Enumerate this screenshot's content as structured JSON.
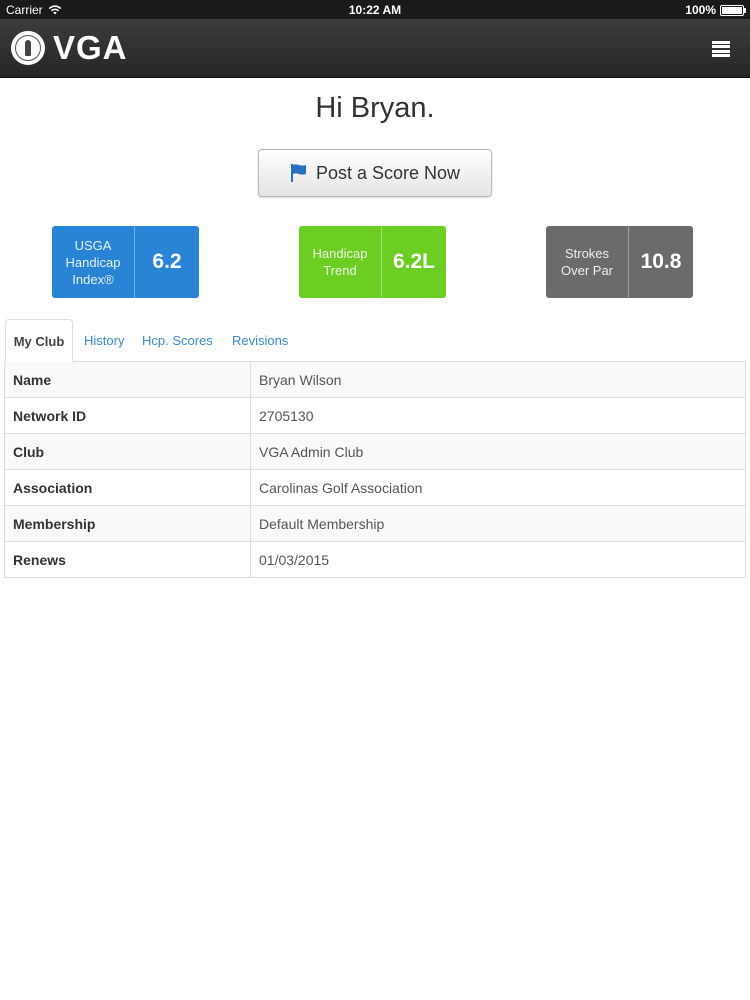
{
  "status_bar": {
    "carrier": "Carrier",
    "time": "10:22 AM",
    "battery": "100%"
  },
  "navbar": {
    "logo_text": "VGA",
    "icons": {
      "menu": "hamburger-menu-icon",
      "logo": "vga-seal-logo"
    }
  },
  "greeting": "Hi Bryan.",
  "post_score": {
    "label": "Post a Score Now",
    "icon": "flag-icon"
  },
  "stats": {
    "handicap_index": {
      "label": "USGA Handicap Index®",
      "value": "6.2",
      "color": "#2a84d6"
    },
    "handicap_trend": {
      "label": "Handicap Trend",
      "value": "6.2L",
      "color": "#6ccd22"
    },
    "strokes_over_par": {
      "label": "Strokes Over Par",
      "value": "10.8",
      "color": "#6b6b6b"
    }
  },
  "tabs": [
    {
      "label": "My Club",
      "active": true
    },
    {
      "label": "History",
      "active": false
    },
    {
      "label": "Hcp. Scores",
      "active": false
    },
    {
      "label": "Revisions",
      "active": false
    }
  ],
  "info": [
    {
      "key": "Name",
      "value": "Bryan Wilson"
    },
    {
      "key": "Network ID",
      "value": "2705130"
    },
    {
      "key": "Club",
      "value": "VGA Admin Club"
    },
    {
      "key": "Association",
      "value": "Carolinas Golf Association"
    },
    {
      "key": "Membership",
      "value": "Default Membership"
    },
    {
      "key": "Renews",
      "value": "01/03/2015"
    }
  ],
  "colors": {
    "link": "#3a8bcf",
    "navbar": "#2e2e2e"
  }
}
